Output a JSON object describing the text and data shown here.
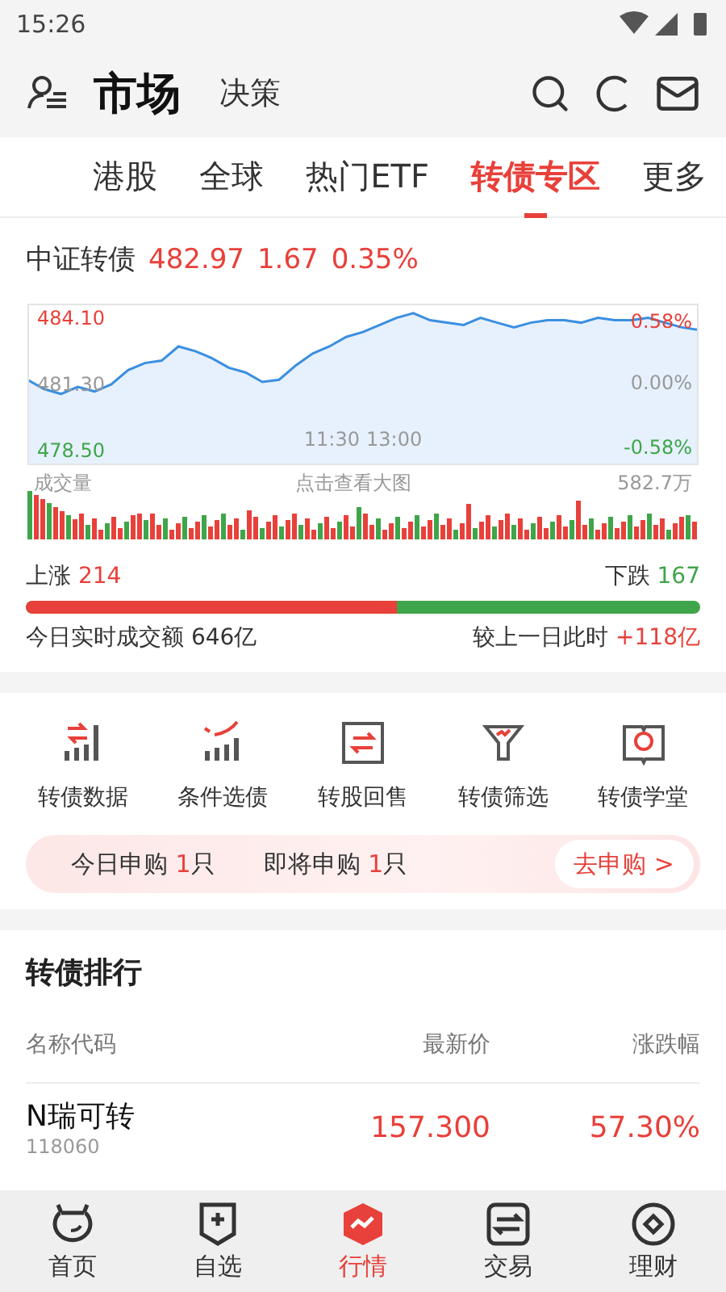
{
  "status_bar": {
    "time": "15:26"
  },
  "header": {
    "title": "市场",
    "subtitle": "决策"
  },
  "tabs": [
    {
      "label": "港股",
      "selected": false
    },
    {
      "label": "全球",
      "selected": false
    },
    {
      "label": "热门ETF",
      "selected": false
    },
    {
      "label": "转债专区",
      "selected": true
    },
    {
      "label": "更多",
      "selected": false
    }
  ],
  "index": {
    "name": "中证转债",
    "price": "482.97",
    "change": "1.67",
    "percent": "0.35%"
  },
  "chart": {
    "pct_high": "0.58%",
    "pct_mid": "0.00%",
    "pct_low": "-0.58%",
    "volume_label": "成交量",
    "hint": "点击查看大图",
    "volume_max": "582.7万",
    "time_1": "11:30",
    "time_2": "13:00",
    "chart_data": {
      "type": "area",
      "categories": [
        null,
        null,
        null,
        null,
        null,
        null,
        null,
        null,
        null,
        null,
        null,
        null,
        null,
        null,
        null,
        null,
        null,
        null,
        null,
        null,
        null,
        null,
        null,
        null,
        null,
        null,
        null,
        null,
        null,
        null,
        null,
        null,
        null,
        null,
        null,
        null,
        null,
        null,
        null,
        null,
        null
      ],
      "series": [
        {
          "color": "#3a8fe0",
          "values": [
            481.5,
            481.1,
            480.9,
            481.2,
            481.0,
            481.3,
            481.9,
            482.2,
            482.3,
            482.9,
            482.7,
            482.4,
            482.0,
            481.8,
            481.4,
            481.5,
            482.1,
            482.6,
            482.9,
            483.3,
            483.5,
            483.8,
            484.1,
            484.3,
            484.0,
            483.9,
            483.8,
            484.1,
            483.9,
            483.7,
            483.9,
            484.0,
            484.0,
            483.9,
            484.1,
            484.0,
            484.0,
            484.1,
            483.9,
            483.7,
            483.6
          ]
        }
      ],
      "ylim": [
        477.9,
        484.7
      ],
      "yticks": [
        {
          "value": 484.1,
          "label": "484.10"
        },
        {
          "value": 481.3,
          "label": "481.30"
        },
        {
          "value": 478.5,
          "label": "478.50"
        }
      ]
    }
  },
  "breadth": {
    "up_label": "上涨",
    "up_count": "214",
    "down_label": "下跌",
    "down_count": "167",
    "level": 0.55,
    "turnover_label": "今日实时成交额",
    "turnover": "646亿",
    "compare_label": "较上一日此时",
    "compare": "+118亿"
  },
  "shortcuts": [
    {
      "label": "转债数据",
      "kind": "data"
    },
    {
      "label": "条件选债",
      "kind": "trend"
    },
    {
      "label": "转股回售",
      "kind": "swap"
    },
    {
      "label": "转债筛选",
      "kind": "filter"
    },
    {
      "label": "转债学堂",
      "kind": "book"
    }
  ],
  "subscription": {
    "today_label": "今日申购",
    "today_count": "1",
    "today_unit": "只",
    "upcoming_label": "即将申购",
    "upcoming_count": "1",
    "upcoming_unit": "只",
    "button": "去申购 >"
  },
  "ranking": {
    "title": "转债排行",
    "columns": [
      "名称代码",
      "最新价",
      "涨跌幅"
    ],
    "rows": [
      {
        "name": "N瑞可转",
        "code": "118060",
        "price": "157.300",
        "change": "57.30%"
      }
    ]
  },
  "bottom_nav": [
    {
      "label": "首页",
      "kind": "home",
      "selected": false
    },
    {
      "label": "自选",
      "kind": "watch",
      "selected": false
    },
    {
      "label": "行情",
      "kind": "market",
      "selected": true
    },
    {
      "label": "交易",
      "kind": "trade",
      "selected": false
    },
    {
      "label": "理财",
      "kind": "wealth",
      "selected": false
    }
  ]
}
